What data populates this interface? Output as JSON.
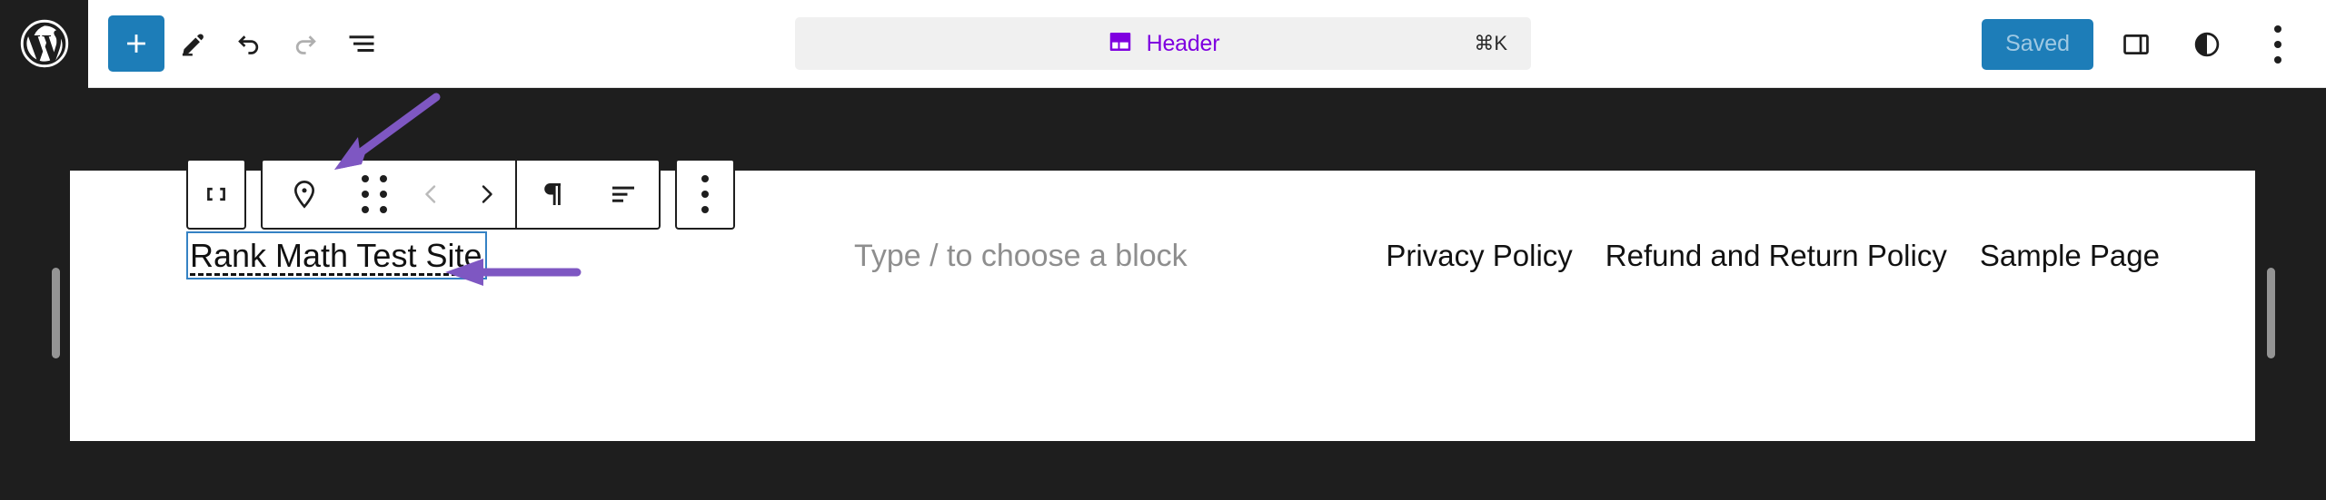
{
  "app": {
    "name": "WordPress Site Editor",
    "accent_blue": "#1d7db8",
    "accent_purple": "#7f00e0",
    "annotation_purple": "#7e57c2",
    "canvas_bg": "#1e1e1e",
    "selection_blue": "#3582c4"
  },
  "topbar": {
    "logo_icon": "wordpress-logo-icon",
    "left_tools": [
      {
        "icon": "plus-icon",
        "label": "Add block",
        "state": "primary"
      },
      {
        "icon": "pencil-icon",
        "label": "Edit",
        "state": "enabled"
      },
      {
        "icon": "undo-arrow-icon",
        "label": "Undo",
        "state": "enabled"
      },
      {
        "icon": "redo-arrow-icon",
        "label": "Redo",
        "state": "disabled"
      },
      {
        "icon": "list-view-icon",
        "label": "Document Overview",
        "state": "enabled"
      }
    ],
    "command_bar": {
      "icon": "template-part-icon",
      "title": "Header",
      "shortcut": "⌘K"
    },
    "right_tools": {
      "save_label": "Saved",
      "save_state": "disabled",
      "buttons": [
        {
          "icon": "settings-sidebar-icon",
          "label": "Settings"
        },
        {
          "icon": "styles-contrast-icon",
          "label": "Styles"
        },
        {
          "icon": "kebab-menu-icon",
          "label": "Options"
        }
      ]
    }
  },
  "block_toolbar": {
    "parent_selector": {
      "icon": "select-parent-icon",
      "label": "Select parent block"
    },
    "items": [
      {
        "icon": "location-pin-icon",
        "label": "Site Logo block type",
        "state": "enabled"
      },
      {
        "icon": "drag-handle-icon",
        "label": "Drag",
        "state": "enabled"
      },
      {
        "icon": "chevron-left-icon",
        "label": "Move left",
        "state": "disabled"
      },
      {
        "icon": "chevron-right-icon",
        "label": "Move right",
        "state": "enabled"
      },
      {
        "icon": "paragraph-mark-icon",
        "label": "Change level",
        "state": "enabled"
      },
      {
        "icon": "align-text-icon",
        "label": "Align text",
        "state": "enabled"
      },
      {
        "icon": "kebab-menu-icon",
        "label": "Options",
        "state": "enabled"
      }
    ]
  },
  "canvas": {
    "site_title": "Rank Math Test Site",
    "block_placeholder": "Type / to choose a block",
    "nav_links": [
      "Privacy Policy",
      "Refund and Return Policy",
      "Sample Page"
    ],
    "resize_handles": [
      "left-resize-handle",
      "right-resize-handle"
    ]
  },
  "annotations": [
    {
      "name": "arrow-to-block-type-icon",
      "direction": "down-left"
    },
    {
      "name": "arrow-to-site-title",
      "direction": "left"
    }
  ]
}
